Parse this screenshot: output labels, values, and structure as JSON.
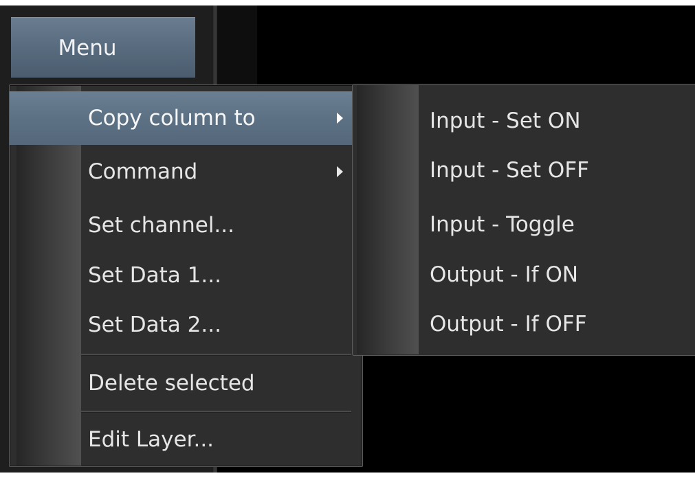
{
  "menu_button": {
    "label": "Menu"
  },
  "popup_menu": {
    "items": [
      {
        "label": "Copy column to",
        "has_submenu": true,
        "highlighted": true
      },
      {
        "label": "Command",
        "has_submenu": true
      },
      {
        "label": "Set channel..."
      },
      {
        "label": "Set Data 1..."
      },
      {
        "label": "Set Data 2..."
      },
      {
        "label": "Delete selected"
      },
      {
        "label": "Edit Layer..."
      }
    ]
  },
  "submenu": {
    "items": [
      {
        "label": "Input - Set ON"
      },
      {
        "label": "Input - Set OFF"
      },
      {
        "label": "Input - Toggle"
      },
      {
        "label": "Output - If ON"
      },
      {
        "label": "Output - If OFF"
      }
    ]
  },
  "colors": {
    "highlight": "#5d7185",
    "menu_background": "#2e2e2e",
    "text": "#e6e6e6"
  }
}
